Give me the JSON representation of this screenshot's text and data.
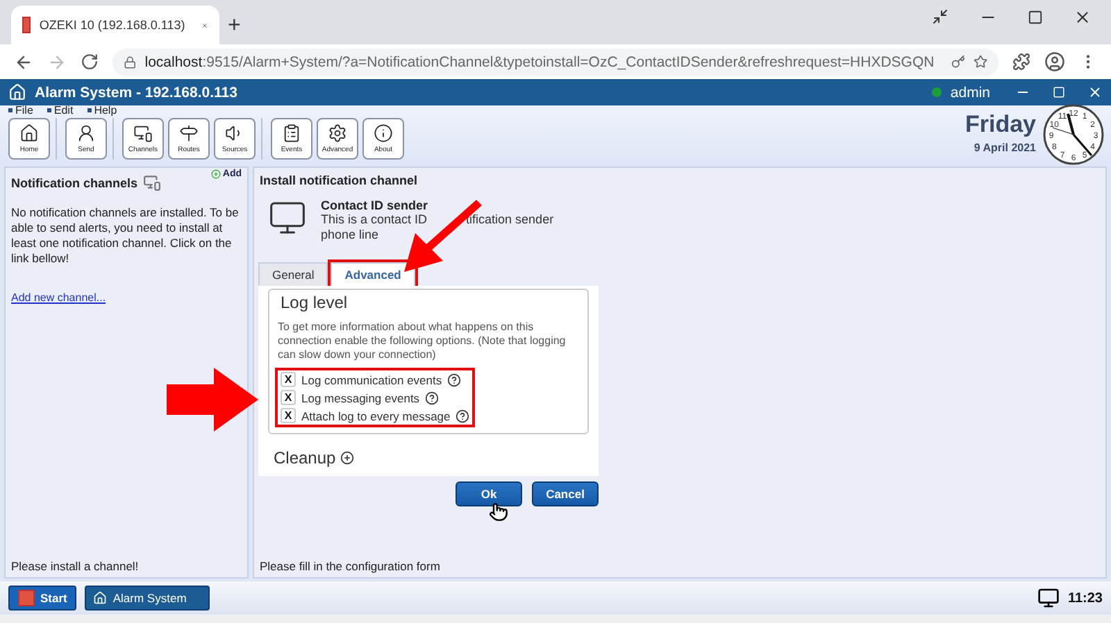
{
  "browser": {
    "tab_title": "OZEKI 10 (192.168.0.113)",
    "new_tab": "+",
    "url_host": "localhost",
    "url_rest": ":9515/Alarm+System/?a=NotificationChannel&typetoinstall=OzC_ContactIDSender&refreshrequest=HHXDSGQN"
  },
  "app": {
    "title": "Alarm System - 192.168.0.113",
    "user": "admin",
    "online": true
  },
  "menu": [
    "File",
    "Edit",
    "Help"
  ],
  "toolbar": [
    [
      "Home"
    ],
    [
      "Send"
    ],
    [
      "Channels",
      "Routes",
      "Sources"
    ],
    [
      "Events",
      "Advanced",
      "About"
    ]
  ],
  "date": {
    "day": "Friday",
    "date": "9 April 2021"
  },
  "clock": {
    "numerals": [
      "12",
      "11",
      "1",
      "10",
      "2",
      "9",
      "3",
      "8",
      "4",
      "7",
      "5",
      "6"
    ]
  },
  "left_panel": {
    "title": "Notification channels",
    "add": "Add",
    "text": "No notification channels are installed. To be able to send alerts, you need to install at least one notification channel. Click on the link bellow!",
    "link": "Add new channel...",
    "status": "Please install a channel!"
  },
  "right_panel": {
    "title": "Install notification channel",
    "channel_name": "Contact ID sender",
    "description": [
      "This is a contact ID",
      "tification sender",
      "phone line"
    ],
    "tabs": [
      {
        "label": "General",
        "selected": false,
        "highlighted": false
      },
      {
        "label": "Advanced",
        "selected": true,
        "highlighted": true
      }
    ],
    "section": "Log level",
    "note": "To get more information about what happens on this connection enable the following options. (Note that logging can slow down your connection)",
    "options_highlighted": true,
    "options": [
      {
        "label": "Log communication events",
        "checked": true,
        "mark": "X"
      },
      {
        "label": "Log messaging events",
        "checked": true,
        "mark": "X"
      },
      {
        "label": "Attach log to every message",
        "checked": true,
        "mark": "X"
      }
    ],
    "cleanup": {
      "label": "Cleanup",
      "expanded": false
    },
    "buttons": [
      {
        "label": "Ok",
        "kind": "primary"
      },
      {
        "label": "Cancel",
        "kind": "primary"
      }
    ],
    "status": "Please fill in the configuration form"
  },
  "taskbar": {
    "start": "Start",
    "task": "Alarm System",
    "time": "11:23"
  }
}
